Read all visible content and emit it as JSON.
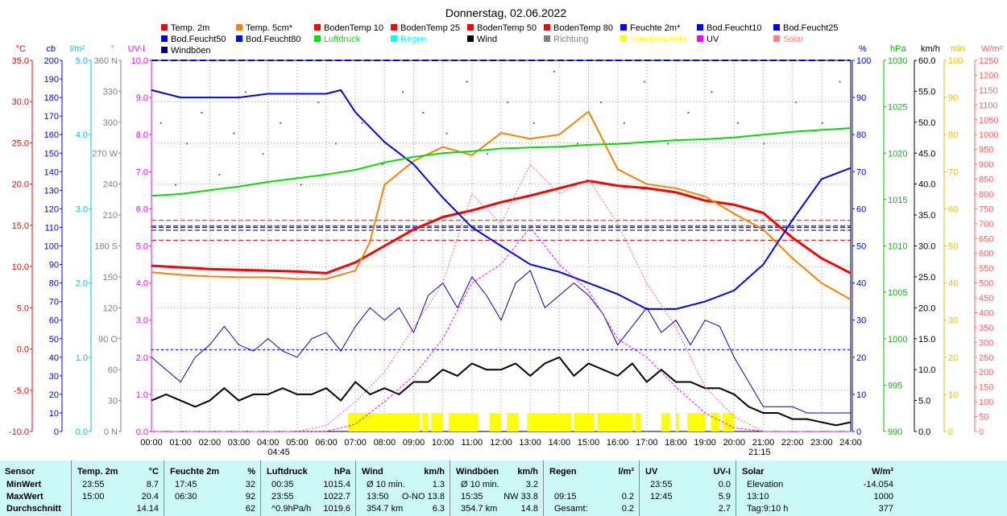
{
  "chart_data": {
    "type": "line",
    "title": "Donnerstag, 02.06.2022",
    "x_ticks": [
      "00:00",
      "01:00",
      "02:00",
      "03:00",
      "04:00",
      "05:00",
      "06:00",
      "07:00",
      "08:00",
      "09:00",
      "10:00",
      "11:00",
      "12:00",
      "13:00",
      "14:00",
      "15:00",
      "16:00",
      "17:00",
      "18:00",
      "19:00",
      "20:00",
      "21:00",
      "22:00",
      "23:00",
      "24:00"
    ],
    "sunrise": "04:45",
    "sunset": "21:15",
    "legend": [
      "Temp. 2m",
      "Temp. 5cm*",
      "BodenTemp 10",
      "BodenTemp 25",
      "BodenTemp 50",
      "BodenTemp 80",
      "Feuchte 2m*",
      "Bod.Feucht10",
      "Bod.Feucht25",
      "Bod.Feucht50",
      "Bod.Feucht80",
      "Luftdruck",
      "Regen",
      "Wind",
      "Richtung",
      "Sonnenschein",
      "UV",
      "Solar",
      "Windböen"
    ],
    "legend_colors": [
      "#ff0000",
      "#ff8000",
      "#ff0000",
      "#ff0000",
      "#ff0000",
      "#ff0000",
      "#0000ff",
      "#0000ff",
      "#0000ff",
      "#0000ff",
      "#0000ff",
      "#00e000",
      "#00ffff",
      "#000000",
      "#808080",
      "#ffff00",
      "#ff00ff",
      "#ff8080",
      "#000080"
    ],
    "axes_left": [
      {
        "unit": "°C",
        "color": "#ff0000",
        "ticks": [
          "35.0",
          "30.0",
          "25.0",
          "20.0",
          "15.0",
          "10.0",
          "5.0",
          "0.0",
          "-5.0",
          "-10.0"
        ]
      },
      {
        "unit": "cb",
        "color": "#0000ff",
        "ticks": [
          "200",
          "190",
          "180",
          "170",
          "160",
          "150",
          "140",
          "130",
          "120",
          "110",
          "100",
          "90",
          "80",
          "70",
          "60",
          "50",
          "40",
          "30",
          "20",
          "10",
          "0"
        ]
      },
      {
        "unit": "l/m²",
        "color": "#00c0ff",
        "ticks": [
          "5.0",
          "4.0",
          "3.0",
          "2.0",
          "1.0",
          "0.0"
        ]
      },
      {
        "unit": "°",
        "color": "#808080",
        "ticks": [
          "360 N",
          "330",
          "300",
          "270 W",
          "240",
          "210",
          "180 S",
          "150",
          "120",
          "90 O",
          "60",
          "30",
          "0 N"
        ]
      },
      {
        "unit": "UV-I",
        "color": "#ff00ff",
        "ticks": [
          "10.0",
          "9.0",
          "8.0",
          "7.0",
          "6.0",
          "5.0",
          "4.0",
          "3.0",
          "2.0",
          "1.0",
          "0.0"
        ]
      }
    ],
    "axes_right": [
      {
        "unit": "%",
        "color": "#0000ff",
        "ticks": [
          "100",
          "90",
          "80",
          "70",
          "60",
          "50",
          "40",
          "30",
          "20",
          "10",
          "0"
        ]
      },
      {
        "unit": "hPa",
        "color": "#00c000",
        "ticks": [
          "1030",
          "1025",
          "1020",
          "1015",
          "1010",
          "1005",
          "1000",
          "995",
          "990"
        ]
      },
      {
        "unit": "km/h",
        "color": "#000000",
        "ticks": [
          "60.0",
          "55.0",
          "50.0",
          "45.0",
          "40.0",
          "35.0",
          "30.0",
          "25.0",
          "20.0",
          "15.0",
          "10.0",
          "5.0",
          "0.0"
        ]
      },
      {
        "unit": "min",
        "color": "#e0c000",
        "ticks": [
          "100",
          "90",
          "80",
          "70",
          "60",
          "50",
          "40",
          "30",
          "20",
          "10",
          "0"
        ]
      },
      {
        "unit": "W/m²",
        "color": "#ff6060",
        "ticks": [
          "1250",
          "1200",
          "1150",
          "1100",
          "1050",
          "1000",
          "950",
          "900",
          "850",
          "800",
          "750",
          "700",
          "650",
          "600",
          "550",
          "500",
          "450",
          "400",
          "350",
          "300",
          "250",
          "200",
          "150",
          "100",
          "50",
          "0"
        ]
      }
    ],
    "series": [
      {
        "name": "Temp. 2m",
        "unit": "°C",
        "hours": [
          0,
          1,
          2,
          3,
          4,
          5,
          6,
          7,
          8,
          9,
          10,
          11,
          12,
          13,
          14,
          15,
          16,
          17,
          18,
          19,
          20,
          21,
          22,
          23,
          24
        ],
        "values": [
          10.1,
          9.9,
          9.7,
          9.6,
          9.5,
          9.4,
          9.2,
          10.5,
          12.5,
          14.5,
          16,
          16.8,
          17.8,
          18.6,
          19.5,
          20.4,
          19.8,
          19.5,
          19,
          18,
          17.5,
          16.5,
          13.5,
          11,
          9.2
        ]
      },
      {
        "name": "Temp. 5cm*",
        "unit": "°C",
        "hours": [
          0,
          1,
          2,
          3,
          4,
          5,
          6,
          7,
          7.5,
          8,
          9,
          10,
          11,
          12,
          13,
          14,
          15,
          16,
          17,
          18,
          19,
          20,
          21,
          22,
          23,
          24
        ],
        "values": [
          9.3,
          9.0,
          8.8,
          8.7,
          8.7,
          8.5,
          8.5,
          9.5,
          13,
          19.9,
          22.8,
          24.5,
          23.5,
          26.2,
          25.5,
          26,
          28.8,
          21.8,
          20,
          19.5,
          18.5,
          16.4,
          14.5,
          11,
          8,
          6
        ]
      },
      {
        "name": "Feuchte 2m*",
        "unit": "%",
        "hours": [
          0,
          1,
          2,
          3,
          4,
          5,
          6,
          6.5,
          7,
          8,
          9,
          10,
          11,
          12,
          13,
          14,
          15,
          16,
          17,
          18,
          19,
          20,
          21,
          22,
          23,
          24
        ],
        "values": [
          92,
          90,
          90,
          90,
          91,
          91,
          91,
          92,
          86,
          78,
          72,
          63,
          55,
          50,
          45,
          43,
          40,
          37,
          33,
          33,
          35,
          38,
          45,
          57,
          68,
          71
        ]
      },
      {
        "name": "Luftdruck",
        "unit": "hPa",
        "hours": [
          0,
          1,
          2,
          3,
          4,
          5,
          6,
          7,
          8,
          9,
          10,
          11,
          12,
          13,
          14,
          15,
          16,
          17,
          18,
          19,
          20,
          21,
          22,
          23,
          24
        ],
        "values": [
          1015.4,
          1015.6,
          1016,
          1016.4,
          1016.9,
          1017.3,
          1017.7,
          1018.2,
          1019,
          1019.6,
          1020,
          1020.2,
          1020.5,
          1020.6,
          1020.7,
          1020.9,
          1021,
          1021.2,
          1021.4,
          1021.5,
          1021.7,
          1022,
          1022.3,
          1022.5,
          1022.7
        ]
      },
      {
        "name": "Wind",
        "unit": "km/h",
        "step": 0.5,
        "values": [
          12,
          10,
          8,
          12,
          14,
          17,
          14,
          13,
          15,
          13,
          12,
          15,
          16,
          13,
          17,
          20,
          18,
          20,
          16,
          22,
          24,
          20,
          25,
          22,
          18,
          24,
          26,
          20,
          22,
          24,
          22,
          19,
          14,
          17,
          20,
          16,
          18,
          14,
          18,
          17,
          12,
          8,
          4,
          4,
          4,
          3,
          3,
          3,
          3
        ]
      },
      {
        "name": "Windböen",
        "unit": "km/h",
        "step": 0.5,
        "values": [
          5,
          6,
          5,
          4,
          5,
          7,
          5,
          6,
          6,
          7,
          6,
          6,
          7,
          5,
          8,
          6,
          7,
          6,
          8,
          8,
          10,
          9,
          11,
          10,
          10,
          11,
          9,
          11,
          12,
          9,
          11,
          10,
          9,
          11,
          8,
          10,
          8,
          8,
          7,
          7,
          6,
          4,
          3,
          3,
          2,
          2,
          1.5,
          1,
          1.5
        ]
      },
      {
        "name": "Solar",
        "unit": "W/m²",
        "step": 1,
        "values": [
          0,
          0,
          0,
          0,
          0,
          0,
          20,
          100,
          200,
          350,
          500,
          800,
          700,
          900,
          800,
          850,
          700,
          500,
          350,
          150,
          50,
          0,
          0,
          0,
          0
        ]
      },
      {
        "name": "UV",
        "unit": "UV-I",
        "step": 1,
        "values": [
          0,
          0,
          0,
          0,
          0,
          0,
          0,
          0.2,
          0.8,
          1.5,
          2.5,
          4,
          4.5,
          5.5,
          4.5,
          3.8,
          2.5,
          2,
          1.2,
          0.5,
          0.1,
          0,
          0,
          0,
          0
        ]
      }
    ],
    "sonnenschein_hours": [
      [
        6.75,
        9.2
      ],
      [
        9.3,
        9.5
      ],
      [
        9.6,
        10.0
      ],
      [
        10.2,
        11.2
      ],
      [
        11.6,
        12.0
      ],
      [
        12.2,
        12.6
      ],
      [
        12.9,
        14.4
      ],
      [
        14.5,
        15.2
      ],
      [
        15.3,
        16.5
      ],
      [
        16.6,
        16.8
      ],
      [
        17.5,
        17.8
      ],
      [
        18.0,
        18.1
      ],
      [
        18.4,
        19.0
      ],
      [
        19.2,
        19.5
      ],
      [
        19.6,
        20.0
      ]
    ],
    "richtung_deg": [
      [
        0.3,
        300
      ],
      [
        0.8,
        240
      ],
      [
        1.2,
        280
      ],
      [
        1.7,
        310
      ],
      [
        2.3,
        250
      ],
      [
        2.8,
        290
      ],
      [
        3.2,
        330
      ],
      [
        3.8,
        270
      ],
      [
        4.4,
        300
      ],
      [
        5.1,
        240
      ],
      [
        5.7,
        320
      ],
      [
        6.3,
        280
      ],
      [
        7.2,
        300
      ],
      [
        7.9,
        260
      ],
      [
        8.6,
        330
      ],
      [
        9.3,
        310
      ],
      [
        10.1,
        290
      ],
      [
        10.8,
        340
      ],
      [
        11.5,
        270
      ],
      [
        12.2,
        320
      ],
      [
        13.1,
        300
      ],
      [
        13.8,
        350
      ],
      [
        14.6,
        280
      ],
      [
        15.4,
        320
      ],
      [
        16.2,
        300
      ],
      [
        16.9,
        340
      ],
      [
        17.7,
        280
      ],
      [
        18.4,
        310
      ],
      [
        19.2,
        330
      ],
      [
        20.1,
        300
      ],
      [
        21.0,
        280
      ],
      [
        22.1,
        320
      ],
      [
        23.0,
        300
      ],
      [
        23.6,
        340
      ]
    ]
  },
  "table": {
    "headers": [
      [
        "Sensor",
        ""
      ],
      [
        "Temp. 2m",
        "°C"
      ],
      [
        "Feuchte 2m",
        "%"
      ],
      [
        "Luftdruck",
        "hPa"
      ],
      [
        "Wind",
        "km/h"
      ],
      [
        "Windböen",
        "km/h"
      ],
      [
        "Regen",
        "l/m²"
      ],
      [
        "UV",
        "UV-I"
      ],
      [
        "Solar",
        "W/m²"
      ]
    ],
    "row_labels": [
      "MinWert",
      "MaxWert",
      "Durchschnitt"
    ],
    "rows": [
      [
        [
          "23:55",
          "8.7"
        ],
        [
          "17:45",
          "32"
        ],
        [
          "00:35",
          "1015.4"
        ],
        [
          "Ø 10 min.",
          "1.3"
        ],
        [
          "Ø 10 min.",
          "3.2"
        ],
        [
          "",
          ""
        ],
        [
          "23:55",
          "0.0"
        ],
        [
          "Elevation",
          "-14.054"
        ]
      ],
      [
        [
          "15:00",
          "20.4"
        ],
        [
          "06:30",
          "92"
        ],
        [
          "23:55",
          "1022.7"
        ],
        [
          "13:50",
          "O-NO 13.8"
        ],
        [
          "15:35",
          "NW 33.8"
        ],
        [
          "09:15",
          "0.2"
        ],
        [
          "12:45",
          "5.9"
        ],
        [
          "13:10",
          "1000"
        ]
      ],
      [
        [
          "",
          "14.14"
        ],
        [
          "",
          "62"
        ],
        [
          "^0.9hPa/h",
          "1019.6"
        ],
        [
          "354.7 km",
          "6.3"
        ],
        [
          "354.7 km",
          "14.8"
        ],
        [
          "Gesamt:",
          "0.2"
        ],
        [
          "",
          "2.7"
        ],
        [
          "Tag:9:10 h",
          "377"
        ]
      ]
    ]
  }
}
